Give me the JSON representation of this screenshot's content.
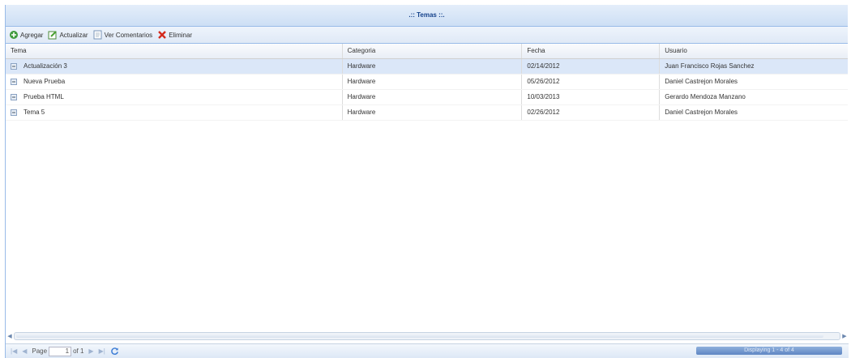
{
  "window": {
    "title": ".:: Temas ::."
  },
  "toolbar": {
    "buttons": [
      {
        "label": "Agregar",
        "icon": "add-icon"
      },
      {
        "label": "Actualizar",
        "icon": "edit-icon"
      },
      {
        "label": "Ver Comentarios",
        "icon": "comments-icon"
      },
      {
        "label": "Eliminar",
        "icon": "delete-icon"
      }
    ]
  },
  "grid": {
    "columns": [
      "Tema",
      "Categoria",
      "Fecha",
      "Usuario"
    ],
    "rows": [
      {
        "tema": "Actualización 3",
        "categoria": "Hardware",
        "fecha": "02/14/2012",
        "usuario": "Juan Francisco Rojas Sanchez",
        "selected": true
      },
      {
        "tema": "Nueva Prueba",
        "categoria": "Hardware",
        "fecha": "05/26/2012",
        "usuario": "Daniel Castrejon Morales",
        "selected": false
      },
      {
        "tema": "Prueba HTML",
        "categoria": "Hardware",
        "fecha": "10/03/2013",
        "usuario": "Gerardo Mendoza Manzano",
        "selected": false
      },
      {
        "tema": "Tema 5",
        "categoria": "Hardware",
        "fecha": "02/26/2012",
        "usuario": "Daniel Castrejon Morales",
        "selected": false
      }
    ]
  },
  "pager": {
    "page_label": "Page",
    "current_page": "1",
    "of_label": "of 1",
    "display_info": "Displaying 1 - 4 of 4",
    "refresh_icon": "refresh-icon"
  },
  "colors": {
    "accent": "#15428b",
    "border": "#99bbe8",
    "selected_row": "#dbe7f8"
  }
}
